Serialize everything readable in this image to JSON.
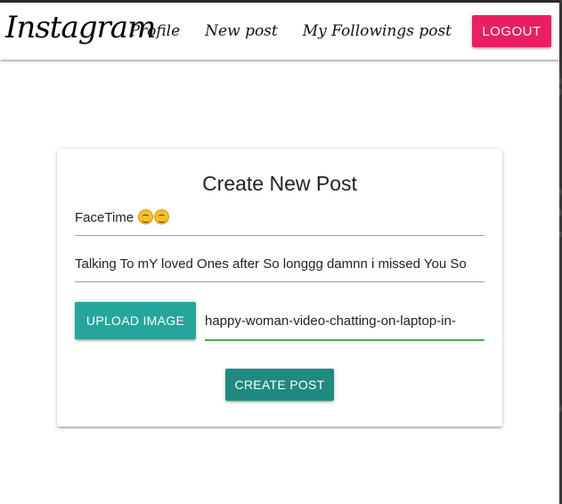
{
  "nav": {
    "brand": "Instagram",
    "links": [
      "Profile",
      "New post",
      "My Followings post"
    ],
    "logout_label": "LOGOUT",
    "logout_color": "#e91e63"
  },
  "card": {
    "title": "Create New Post",
    "title_field_value": "FaceTime",
    "title_field_emojis": "smiling-face-icon x2",
    "body_field_value": "Talking To mY loved Ones after So longgg damnn i missed You So",
    "upload_label": "UPLOAD IMAGE",
    "file_path_value": "happy-woman-video-chatting-on-laptop-in-",
    "create_label": "CREATE POST",
    "accent_color": "#26a69a",
    "file_path_underline_color": "#4caf50"
  }
}
